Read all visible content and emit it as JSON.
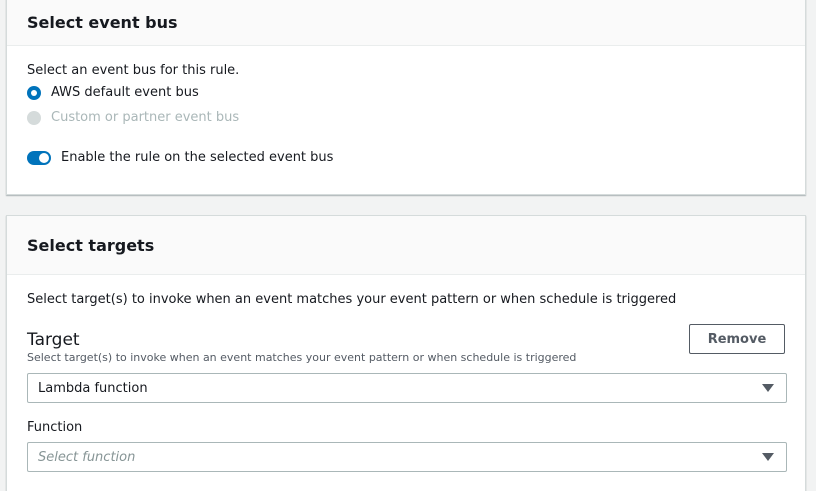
{
  "event_bus_panel": {
    "title": "Select event bus",
    "description": "Select an event bus for this rule.",
    "options": [
      {
        "label": "AWS default event bus",
        "selected": true,
        "disabled": false
      },
      {
        "label": "Custom or partner event bus",
        "selected": false,
        "disabled": true
      }
    ],
    "toggle": {
      "label": "Enable the rule on the selected event bus",
      "on": true
    }
  },
  "targets_panel": {
    "title": "Select targets",
    "description": "Select target(s) to invoke when an event matches your event pattern or when schedule is triggered",
    "target": {
      "title": "Target",
      "subtitle": "Select target(s) to invoke when an event matches your event pattern or when schedule is triggered",
      "remove_label": "Remove",
      "selected_value": "Lambda function"
    },
    "function": {
      "label": "Function",
      "placeholder": "Select function"
    }
  },
  "colors": {
    "accent": "#0073bb",
    "disabled": "#d5dbdb",
    "border": "#aab7b8"
  }
}
